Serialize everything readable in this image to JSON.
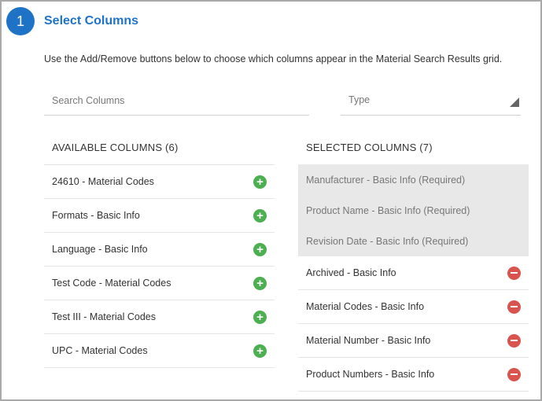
{
  "step": {
    "number": "1",
    "title": "Select Columns"
  },
  "description": "Use the Add/Remove buttons below to choose which columns appear in the Material Search Results grid.",
  "search": {
    "placeholder": "Search Columns",
    "value": ""
  },
  "type_select": {
    "placeholder": "Type"
  },
  "available": {
    "header": "AVAILABLE COLUMNS (6)",
    "items": [
      {
        "label": "24610 - Material Codes",
        "action_icon": "add-icon"
      },
      {
        "label": "Formats - Basic Info",
        "action_icon": "add-icon"
      },
      {
        "label": "Language - Basic Info",
        "action_icon": "add-icon"
      },
      {
        "label": "Test Code - Material Codes",
        "action_icon": "add-icon"
      },
      {
        "label": "Test III - Material Codes",
        "action_icon": "add-icon"
      },
      {
        "label": "UPC - Material Codes",
        "action_icon": "add-icon"
      }
    ]
  },
  "selected": {
    "header": "SELECTED COLUMNS (7)",
    "required_items": [
      {
        "label": "Manufacturer - Basic Info (Required)"
      },
      {
        "label": "Product Name - Basic Info (Required)"
      },
      {
        "label": "Revision Date - Basic Info (Required)"
      }
    ],
    "items": [
      {
        "label": "Archived - Basic Info",
        "action_icon": "remove-icon"
      },
      {
        "label": "Material Codes - Basic Info",
        "action_icon": "remove-icon"
      },
      {
        "label": "Material Number - Basic Info",
        "action_icon": "remove-icon"
      },
      {
        "label": "Product Numbers - Basic Info",
        "action_icon": "remove-icon"
      }
    ]
  },
  "colors": {
    "accent": "#1e73c7",
    "add": "#4caf50",
    "remove": "#d9534f",
    "required_bg": "#e8e8e8"
  }
}
